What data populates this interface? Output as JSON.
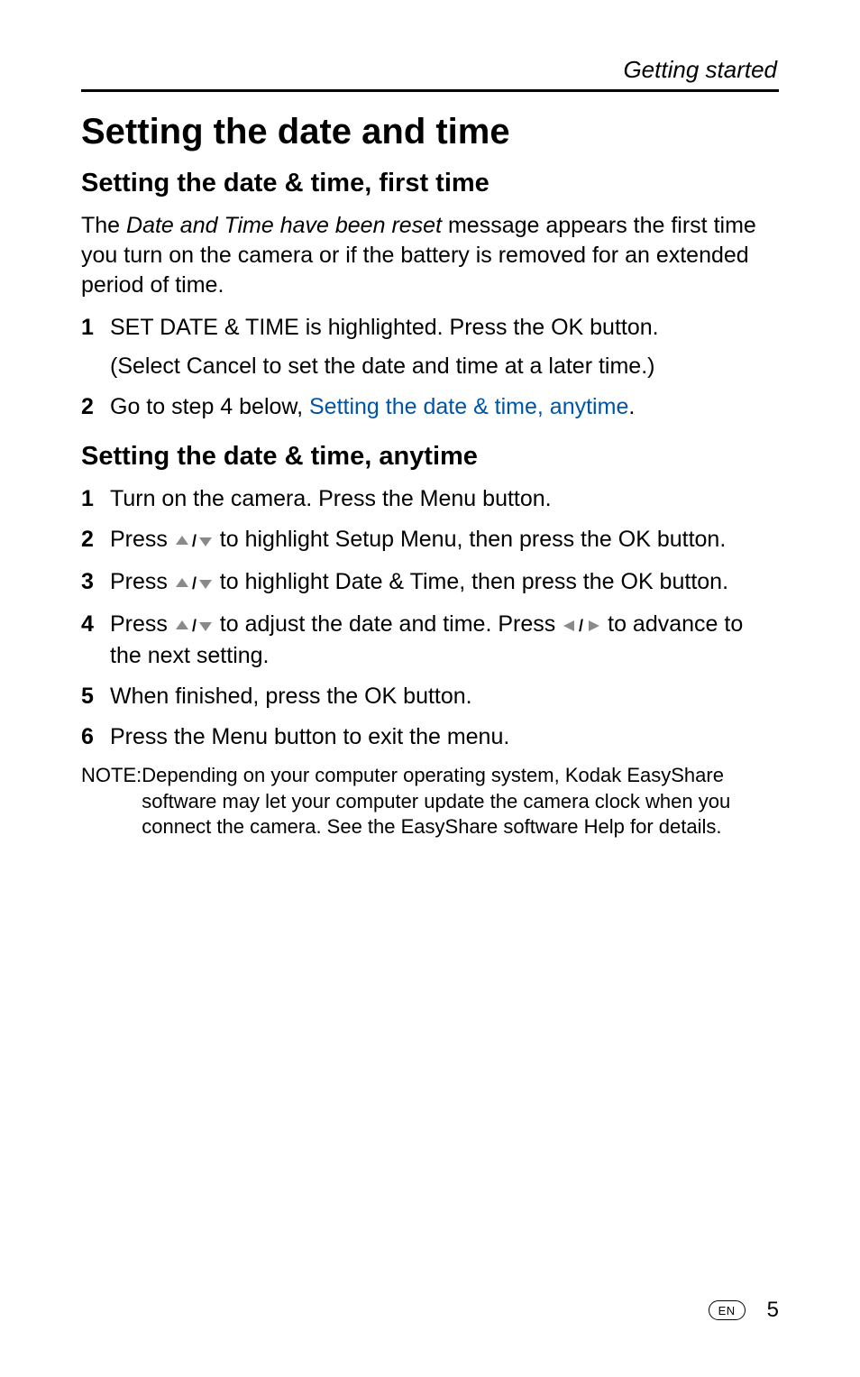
{
  "header": {
    "section_label": "Getting started"
  },
  "title": "Setting the date and time",
  "section_first": {
    "heading": "Setting the date & time, first time",
    "intro_prefix": "The ",
    "intro_ital": "Date and Time have been reset",
    "intro_suffix": " message appears the first time you turn on the camera or if the battery is removed for an extended period of time.",
    "steps": [
      {
        "num": "1",
        "text": "SET DATE & TIME is highlighted. Press the OK button.",
        "sub": "(Select Cancel to set the date and time at a later time.)"
      },
      {
        "num": "2",
        "text_prefix": "Go to step 4 below, ",
        "link_text": "Setting the date & time, anytime",
        "text_suffix": "."
      }
    ]
  },
  "section_anytime": {
    "heading": "Setting the date & time, anytime",
    "steps": [
      {
        "num": "1",
        "text": "Turn on the camera. Press the Menu button."
      },
      {
        "num": "2",
        "pre": "Press ",
        "icon": "updown",
        "post": " to highlight Setup Menu, then press the OK button."
      },
      {
        "num": "3",
        "pre": "Press ",
        "icon": "updown",
        "post": " to highlight Date & Time, then press the OK button."
      },
      {
        "num": "4",
        "pre": "Press ",
        "icon": "updown",
        "mid": " to adjust the date and time. Press ",
        "icon2": "leftright",
        "post": "  to advance to the next setting."
      },
      {
        "num": "5",
        "text": "When finished, press the OK button."
      },
      {
        "num": "6",
        "text": "Press the Menu button to exit the menu."
      }
    ],
    "note_label": "NOTE:",
    "note_body": "Depending on your computer operating system, Kodak EasyShare software may let your computer update the camera clock when you connect the camera. See the EasyShare software Help for details."
  },
  "footer": {
    "lang": "EN",
    "page_number": "5"
  },
  "icons": {
    "updown_alt": "up/down",
    "leftright_alt": "left/right"
  }
}
